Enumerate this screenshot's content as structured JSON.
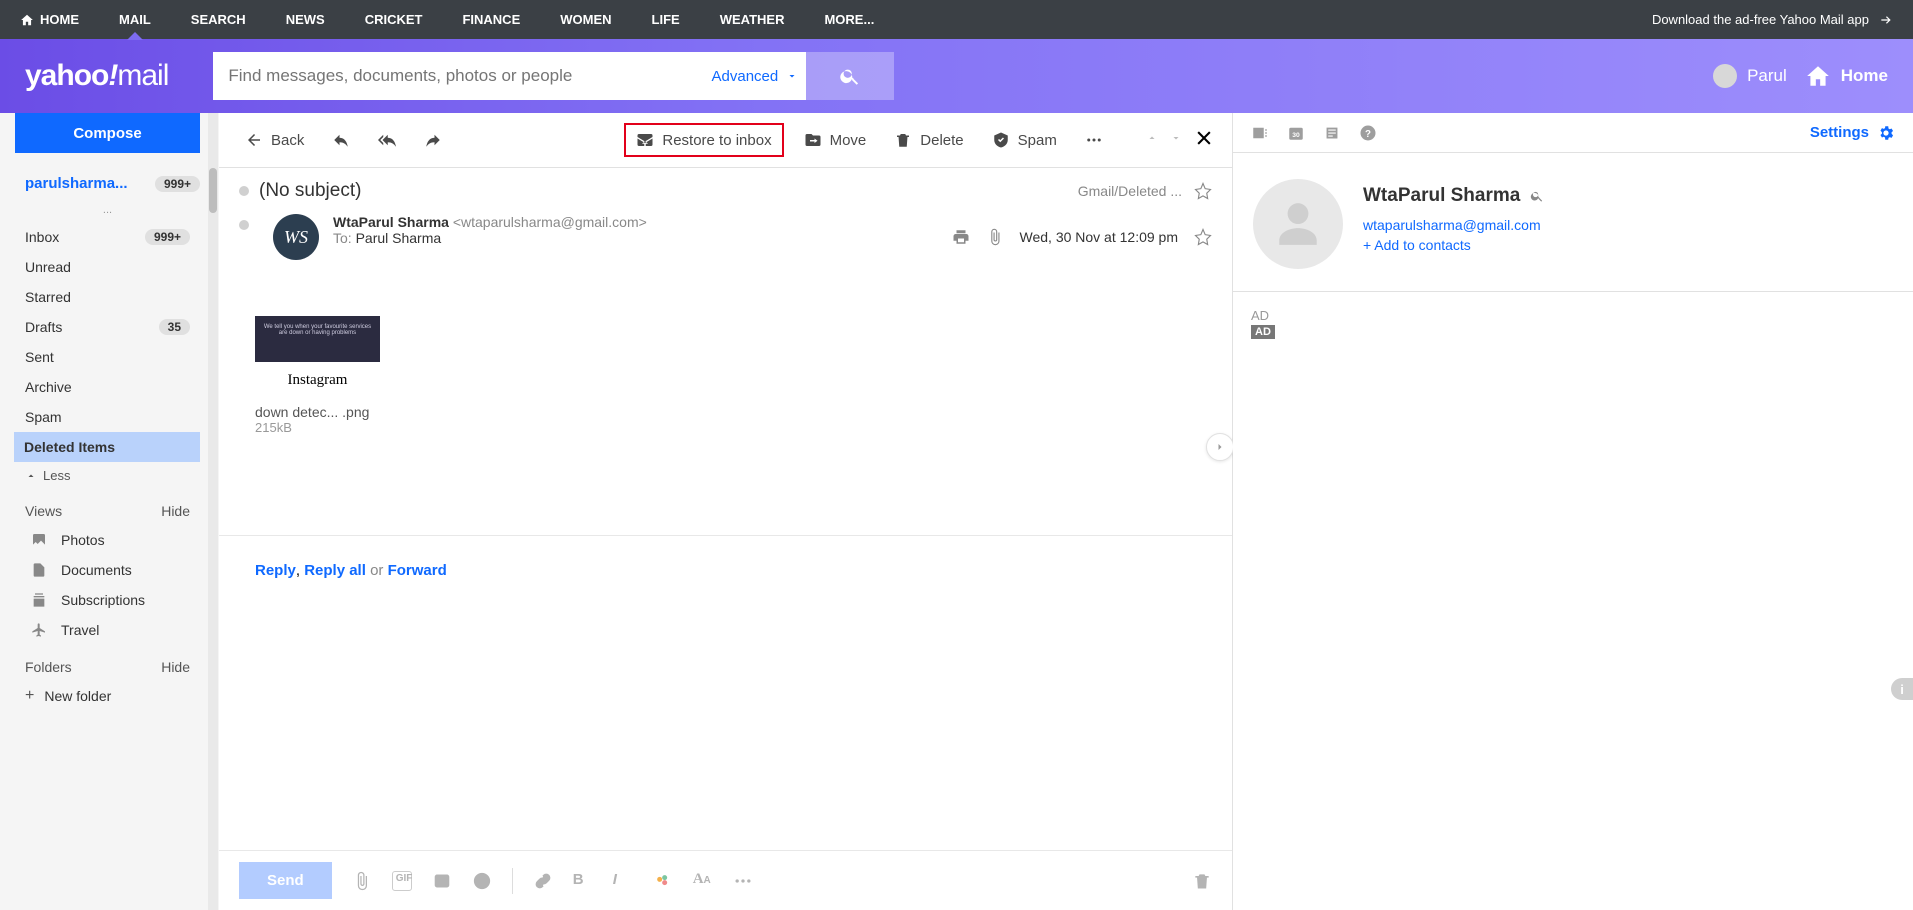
{
  "topnav": {
    "items": [
      "HOME",
      "MAIL",
      "SEARCH",
      "NEWS",
      "CRICKET",
      "FINANCE",
      "WOMEN",
      "LIFE",
      "WEATHER",
      "MORE..."
    ],
    "download": "Download the ad-free Yahoo Mail app"
  },
  "header": {
    "logo1": "yahoo",
    "logo2": "!",
    "logo3": "mail",
    "search_placeholder": "Find messages, documents, photos or people",
    "advanced": "Advanced",
    "username": "Parul",
    "home": "Home"
  },
  "sidebar": {
    "compose": "Compose",
    "account": "parulsharma...",
    "account_badge": "999+",
    "dots": "...",
    "folders": [
      {
        "label": "Inbox",
        "badge": "999+",
        "sel": false
      },
      {
        "label": "Unread",
        "badge": "",
        "sel": false
      },
      {
        "label": "Starred",
        "badge": "",
        "sel": false
      },
      {
        "label": "Drafts",
        "badge": "35",
        "sel": false
      },
      {
        "label": "Sent",
        "badge": "",
        "sel": false
      },
      {
        "label": "Archive",
        "badge": "",
        "sel": false
      },
      {
        "label": "Spam",
        "badge": "",
        "sel": false
      },
      {
        "label": "Deleted Items",
        "badge": "",
        "sel": true
      }
    ],
    "less": "Less",
    "views_header": "Views",
    "hide": "Hide",
    "views": [
      "Photos",
      "Documents",
      "Subscriptions",
      "Travel"
    ],
    "folders_header": "Folders",
    "new_folder": "New folder"
  },
  "toolbar": {
    "back": "Back",
    "restore": "Restore to inbox",
    "move": "Move",
    "delete": "Delete",
    "spam": "Spam"
  },
  "message": {
    "subject": "(No subject)",
    "folder": "Gmail/Deleted ...",
    "from_name": "WtaParul Sharma",
    "from_addr": "<wtaparulsharma@gmail.com>",
    "to_label": "To:",
    "to_name": "Parul Sharma",
    "date": "Wed, 30 Nov at 12:09 pm",
    "attach_name": "down detec... .png",
    "attach_size": "215kB",
    "instagram": "Instagram",
    "thumb_txt": "We tell you when your favourite services are down or having problems"
  },
  "actions": {
    "reply": "Reply",
    "comma": ", ",
    "replyall": "Reply all",
    "or": " or ",
    "forward": "Forward"
  },
  "compose_bar": {
    "send": "Send"
  },
  "rpanel": {
    "settings": "Settings",
    "contact_name": "WtaParul Sharma",
    "contact_email": "wtaparulsharma@gmail.com",
    "add": "+ Add to contacts",
    "ad": "AD",
    "adbadge": "AD"
  }
}
